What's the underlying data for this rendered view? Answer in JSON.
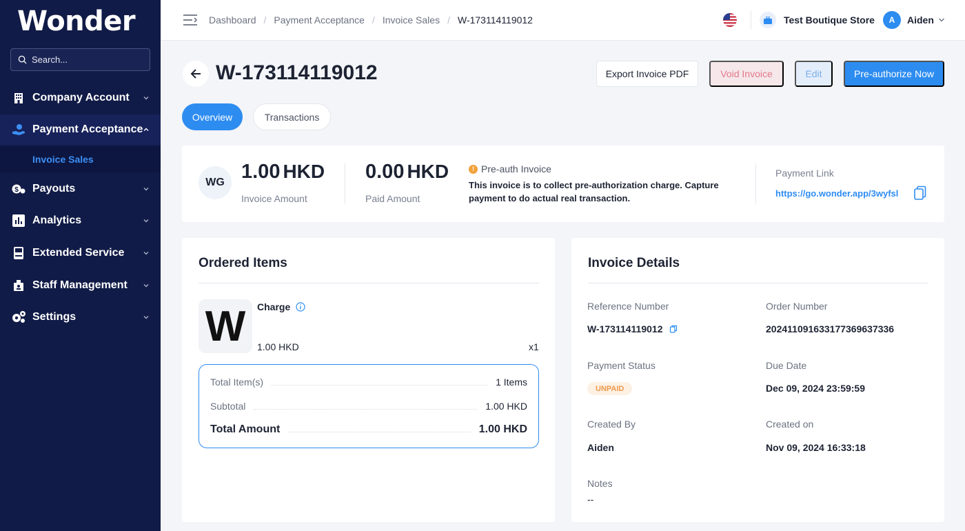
{
  "sidebar": {
    "logo": "Wonder",
    "search_placeholder": "Search...",
    "items": [
      {
        "label": "Company Account",
        "icon": "building-icon"
      },
      {
        "label": "Payment Acceptance",
        "icon": "hand-coin-icon"
      },
      {
        "label": "Payouts",
        "icon": "payout-icon"
      },
      {
        "label": "Analytics",
        "icon": "bar-chart-icon"
      },
      {
        "label": "Extended Service",
        "icon": "terminal-icon"
      },
      {
        "label": "Staff Management",
        "icon": "staff-icon"
      },
      {
        "label": "Settings",
        "icon": "gears-icon"
      }
    ],
    "sub_item": "Invoice Sales"
  },
  "topbar": {
    "breadcrumbs": [
      "Dashboard",
      "Payment Acceptance",
      "Invoice Sales",
      "W-173114119012"
    ],
    "store_name": "Test Boutique Store",
    "user_initial": "A",
    "user_name": "Aiden"
  },
  "page": {
    "title": "W-173114119012",
    "buttons": {
      "export": "Export Invoice PDF",
      "void": "Void Invoice",
      "edit": "Edit",
      "preauth": "Pre-authorize Now"
    },
    "tabs": [
      "Overview",
      "Transactions"
    ]
  },
  "summary": {
    "avatar": "WG",
    "invoice_amount": "1.00",
    "invoice_currency": "HKD",
    "invoice_amount_label": "Invoice Amount",
    "paid_amount": "0.00",
    "paid_currency": "HKD",
    "paid_amount_label": "Paid Amount",
    "preauth_title": "Pre-auth Invoice",
    "preauth_desc": "This invoice is to collect pre-authorization charge. Capture payment to do actual real transaction.",
    "payment_link_label": "Payment Link",
    "payment_link": "https://go.wonder.app/3wyfsl"
  },
  "ordered": {
    "title": "Ordered Items",
    "item": {
      "thumb": "W",
      "name": "Charge",
      "price": "1.00 HKD",
      "qty": "x1"
    },
    "totals": [
      {
        "label": "Total Item(s)",
        "value": "1 Items"
      },
      {
        "label": "Subtotal",
        "value": "1.00 HKD"
      },
      {
        "label": "Total Amount",
        "value": "1.00 HKD"
      }
    ]
  },
  "details": {
    "title": "Invoice Details",
    "reference_label": "Reference Number",
    "reference": "W-173114119012",
    "order_label": "Order Number",
    "order": "20241109163317736963733​6",
    "status_label": "Payment Status",
    "status": "UNPAID",
    "due_label": "Due Date",
    "due": "Dec 09, 2024 23:59:59",
    "created_by_label": "Created By",
    "created_by": "Aiden",
    "created_on_label": "Created on",
    "created_on": "Nov 09, 2024 16:33:18",
    "notes_label": "Notes",
    "notes": "--"
  },
  "colors": {
    "sidebar_bg": "#111b47",
    "accent": "#2d8cf0",
    "void": "#e4788a",
    "unpaid": "#f0994a"
  }
}
